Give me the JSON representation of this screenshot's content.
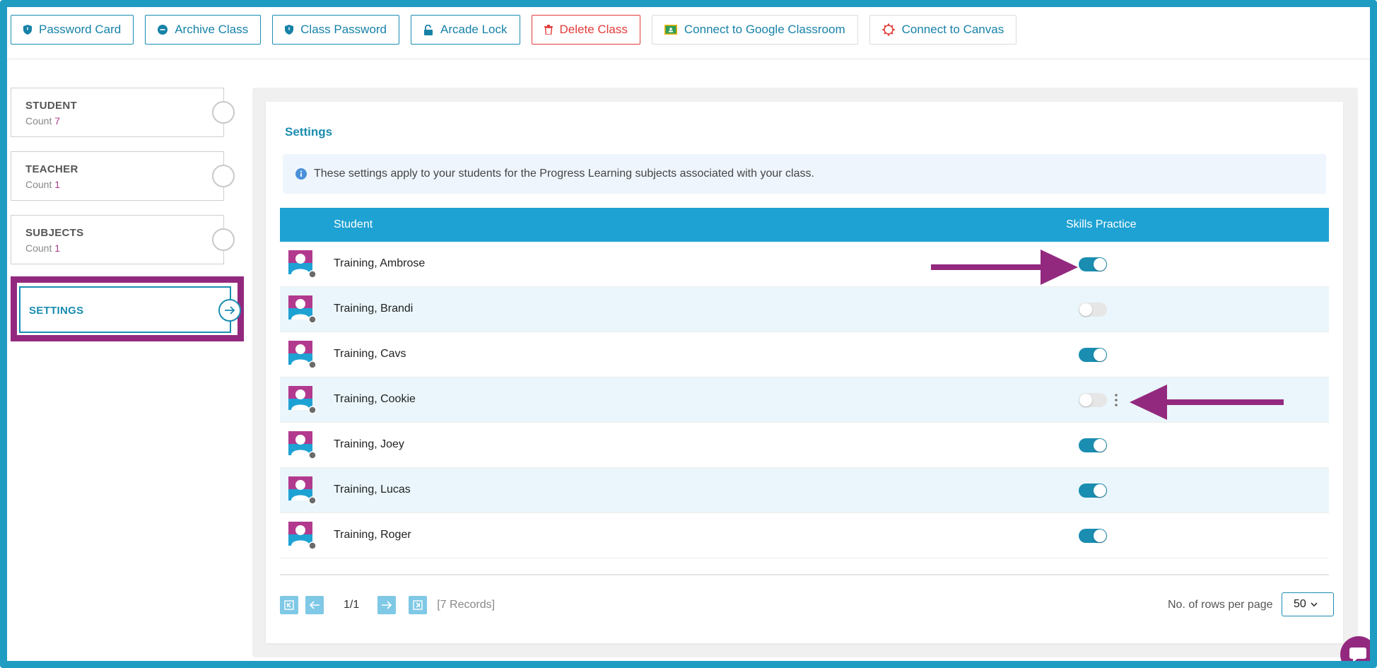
{
  "toolbar": {
    "buttons": [
      {
        "label": "Password Card",
        "icon": "shield-icon"
      },
      {
        "label": "Archive Class",
        "icon": "minus-circle-icon"
      },
      {
        "label": "Class Password",
        "icon": "shield-icon"
      },
      {
        "label": "Arcade Lock",
        "icon": "unlock-icon"
      },
      {
        "label": "Delete Class",
        "icon": "trash-icon"
      },
      {
        "label": "Connect to Google Classroom",
        "icon": "google-classroom-icon"
      },
      {
        "label": "Connect to Canvas",
        "icon": "canvas-icon"
      }
    ]
  },
  "sidebar": {
    "items": [
      {
        "title": "STUDENT",
        "count_label": "Count",
        "count": "7"
      },
      {
        "title": "TEACHER",
        "count_label": "Count",
        "count": "1"
      },
      {
        "title": "SUBJECTS",
        "count_label": "Count",
        "count": "1"
      },
      {
        "title": "SETTINGS"
      }
    ]
  },
  "main": {
    "title": "Settings",
    "info": "These settings apply to your students for the Progress Learning subjects associated with your class.",
    "table": {
      "headers": {
        "student": "Student",
        "skills": "Skills Practice"
      },
      "rows": [
        {
          "name": "Training, Ambrose",
          "skills_practice": true
        },
        {
          "name": "Training, Brandi",
          "skills_practice": false
        },
        {
          "name": "Training, Cavs",
          "skills_practice": true
        },
        {
          "name": "Training, Cookie",
          "skills_practice": false
        },
        {
          "name": "Training, Joey",
          "skills_practice": true
        },
        {
          "name": "Training, Lucas",
          "skills_practice": true
        },
        {
          "name": "Training, Roger",
          "skills_practice": true
        }
      ]
    },
    "pager": {
      "page_info": "1/1",
      "records": "[7 Records]",
      "rows_label": "No. of rows per page",
      "rows_value": "50"
    }
  },
  "colors": {
    "frame": "#1e9cc2",
    "accent": "#1a8db0",
    "highlight": "#93297f",
    "danger": "#e23b3b",
    "count": "#b23a8e"
  }
}
